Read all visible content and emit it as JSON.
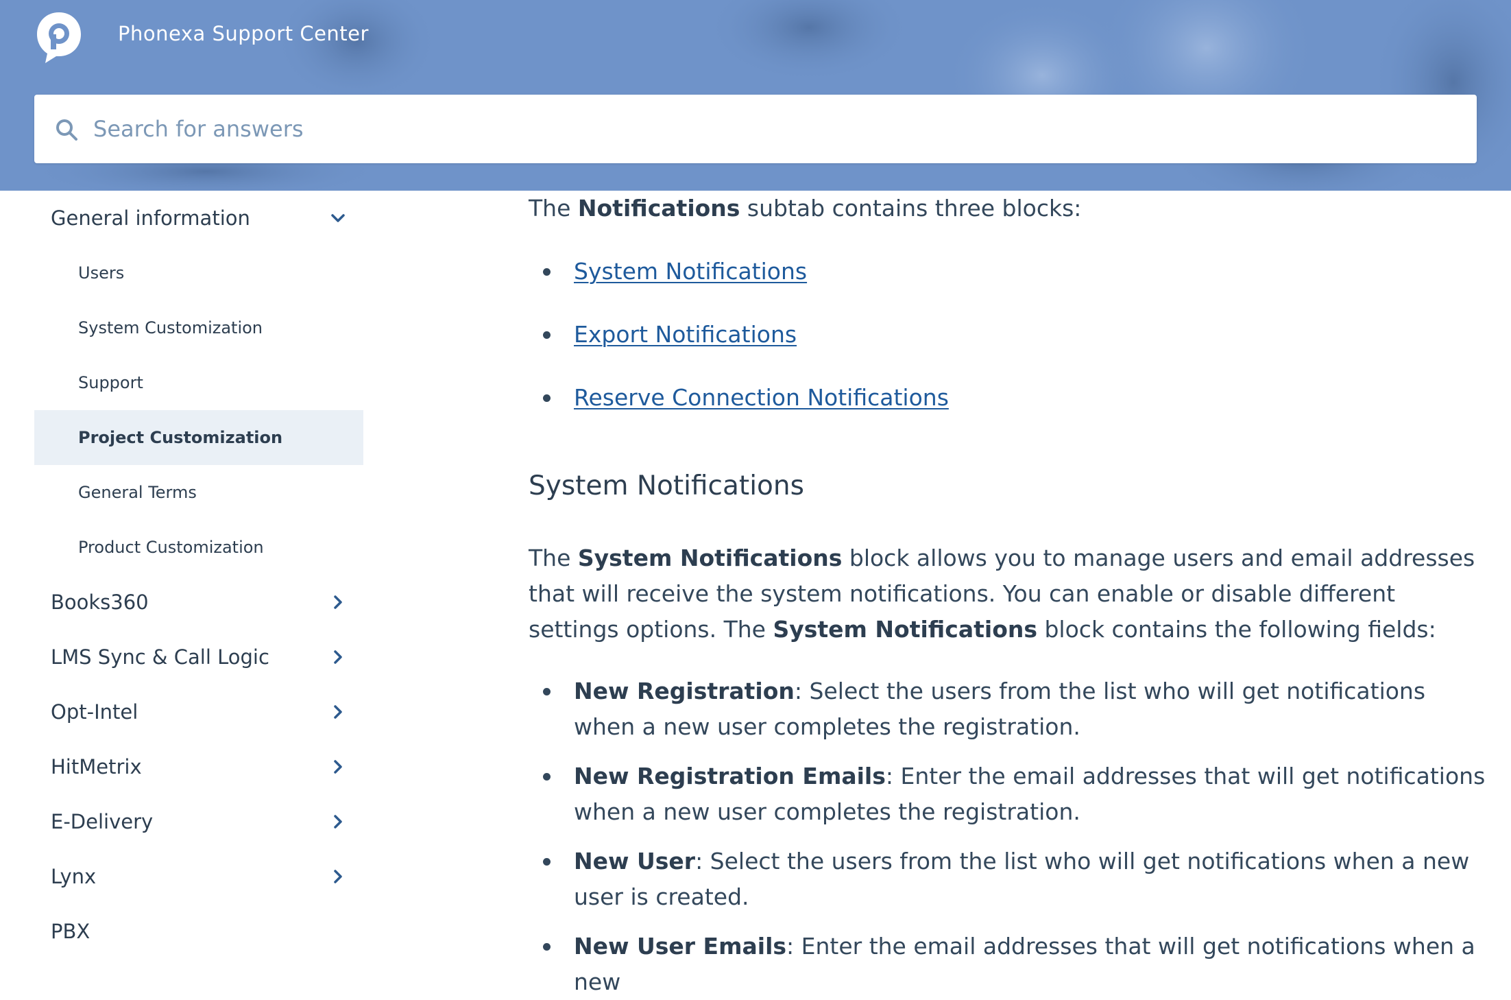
{
  "header": {
    "site_title": "Phonexa Support Center",
    "search_placeholder": "Search for answers"
  },
  "sidebar": {
    "section_open": {
      "label": "General information",
      "items": [
        {
          "label": "Users",
          "active": false
        },
        {
          "label": "System Customization",
          "active": false
        },
        {
          "label": "Support",
          "active": false
        },
        {
          "label": "Project Customization",
          "active": true
        },
        {
          "label": "General Terms",
          "active": false
        },
        {
          "label": "Product Customization",
          "active": false
        }
      ]
    },
    "sections": [
      {
        "label": "Books360",
        "has_children": true
      },
      {
        "label": "LMS Sync & Call Logic",
        "has_children": true
      },
      {
        "label": "Opt-Intel",
        "has_children": true
      },
      {
        "label": "HitMetrix",
        "has_children": true
      },
      {
        "label": "E-Delivery",
        "has_children": true
      },
      {
        "label": "Lynx",
        "has_children": true
      },
      {
        "label": "PBX",
        "has_children": false
      }
    ]
  },
  "article": {
    "intro": {
      "pre": "The ",
      "bold": "Notifications",
      "post": " subtab contains three blocks:"
    },
    "links": [
      "System Notifications",
      "Export Notifications",
      "Reserve Connection Notifications"
    ],
    "section_heading": "System Notifications",
    "paragraph": {
      "p1": "The ",
      "b1": "System Notifications",
      "p2": " block allows you to manage users and email addresses that will receive the system notifications. You can enable or disable different settings options. The ",
      "b2": "System Notifications",
      "p3": " block contains the following fields:"
    },
    "fields": [
      {
        "term": "New Registration",
        "desc": ": Select the users from the list who will get notifications when a new user completes the registration."
      },
      {
        "term": "New Registration Emails",
        "desc": ": Enter the email addresses that will get notifications when a new user completes the registration."
      },
      {
        "term": "New User",
        "desc": ": Select the users from the list who will get notifications when a new user is created."
      },
      {
        "term": "New User Emails",
        "desc": ": Enter the email addresses that will get notifications when a new"
      }
    ]
  },
  "colors": {
    "header_bg": "#6f93c9",
    "link": "#1e5a9c",
    "active_bg": "#eaf0f6",
    "text": "#33475b"
  }
}
